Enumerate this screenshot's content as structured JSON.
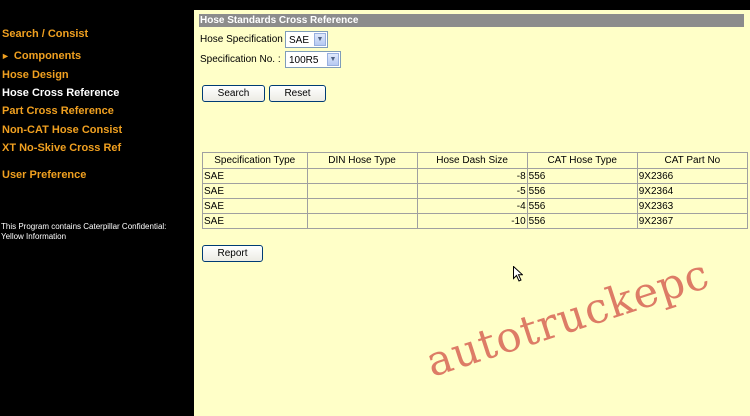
{
  "sidebar": {
    "items": [
      {
        "label": "Search / Consist"
      },
      {
        "label": "Components"
      },
      {
        "label": "Hose Design"
      },
      {
        "label": "Hose Cross Reference"
      },
      {
        "label": "Part Cross Reference"
      },
      {
        "label": "Non-CAT Hose Consist"
      },
      {
        "label": "XT No-Skive Cross Ref"
      },
      {
        "label": "User Preference"
      }
    ],
    "confidential": "This Program contains Caterpillar Confidential: Yellow Information"
  },
  "main": {
    "title": "Hose Standards Cross Reference",
    "spec_label": "Hose Specification :",
    "spec_value": "SAE",
    "specno_label": "Specification No. :",
    "specno_value": "100R5",
    "search_label": "Search",
    "reset_label": "Reset",
    "report_label": "Report",
    "table": {
      "headers": [
        "Specification Type",
        "DIN Hose Type",
        "Hose Dash Size",
        "CAT Hose Type",
        "CAT Part No"
      ],
      "rows": [
        [
          "SAE",
          "",
          "-8",
          "556",
          "9X2366"
        ],
        [
          "SAE",
          "",
          "-5",
          "556",
          "9X2364"
        ],
        [
          "SAE",
          "",
          "-4",
          "556",
          "9X2363"
        ],
        [
          "SAE",
          "",
          "-10",
          "556",
          "9X2367"
        ]
      ]
    }
  },
  "watermark": "autotruckepc"
}
